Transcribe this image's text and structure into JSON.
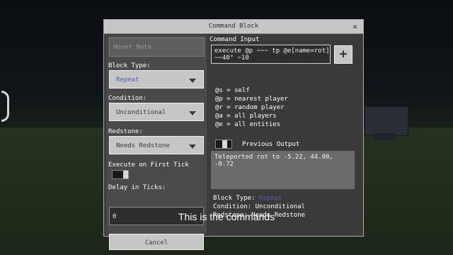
{
  "window": {
    "title": "Command Block",
    "close_icon": "close-icon"
  },
  "left": {
    "hover_note_placeholder": "Hover Note",
    "block_type_label": "Block Type:",
    "block_type_value": "Repeat",
    "condition_label": "Condition:",
    "condition_value": "Unconditional",
    "redstone_label": "Redstone:",
    "redstone_value": "Needs Redstone",
    "first_tick_label": "Execute on First Tick",
    "delay_label": "Delay in Ticks:",
    "delay_value": "0",
    "cancel_label": "Cancel"
  },
  "right": {
    "command_input_label": "Command Input",
    "command_text": "execute @p ~~~ tp @e[name=rot]\n~~40° ~10",
    "help": [
      "@s = self",
      "@p = nearest player",
      "@r = random player",
      "@a = all players",
      "@e = all entities"
    ],
    "previous_output_label": "Previous Output",
    "output_text": "Teleported rot to -5.22, 44.00, -0.72",
    "summary_block_type_label": "Block Type: ",
    "summary_block_type_value": "Repeat",
    "summary_condition": "Condition: Unconditional",
    "summary_redstone": "Redstone: Needs Redstone"
  },
  "subtitle": "This is the commands",
  "colors": {
    "accent": "#4f5bb8",
    "panel": "#3c3c3c",
    "button": "#c6c6c6"
  }
}
